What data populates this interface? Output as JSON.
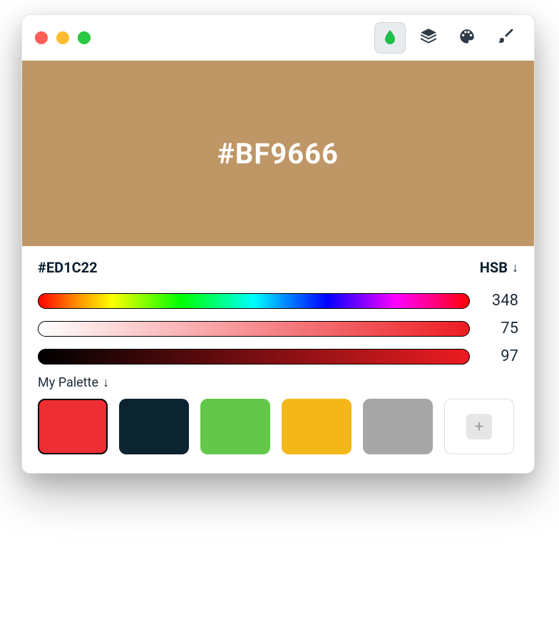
{
  "traffic_lights": {
    "red": "#ff5f57",
    "yellow": "#febc2e",
    "green": "#28c840"
  },
  "toolbar": {
    "tabs": [
      "drop",
      "layers",
      "palette",
      "brush"
    ],
    "active_index": 0
  },
  "preview": {
    "bg": "#BF9666",
    "label": "#BF9666"
  },
  "current_hex": "#ED1C22",
  "mode": {
    "label": "HSB"
  },
  "sliders": {
    "hue": 348,
    "sat": 75,
    "bri": 97
  },
  "palette": {
    "label": "My Palette",
    "swatches": [
      {
        "color": "#ED2E33",
        "selected": true
      },
      {
        "color": "#0C2430",
        "selected": false
      },
      {
        "color": "#63C84A",
        "selected": false
      },
      {
        "color": "#F4B71A",
        "selected": false
      },
      {
        "color": "#A6A6A6",
        "selected": false
      }
    ]
  },
  "icons": {
    "add": "+"
  }
}
